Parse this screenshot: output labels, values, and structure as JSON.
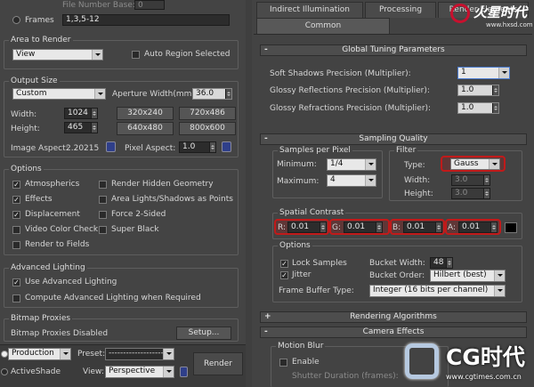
{
  "left": {
    "file_number_base_label": "File Number Base:",
    "file_number_base_value": "0",
    "frames_label": "Frames",
    "frames_value": "1,3,5-12",
    "area_to_render": {
      "title": "Area to Render",
      "selected": "View",
      "auto_region_label": "Auto Region Selected"
    },
    "output_size": {
      "title": "Output Size",
      "preset": "Custom",
      "aperture_label": "Aperture Width(mm):",
      "aperture_value": "36.0",
      "width_label": "Width:",
      "width_value": "1024",
      "height_label": "Height:",
      "height_value": "465",
      "presets": [
        "320x240",
        "720x486",
        "640x480",
        "800x600"
      ],
      "image_aspect_label": "Image Aspect:",
      "image_aspect_value": "2.20215",
      "pixel_aspect_label": "Pixel Aspect:",
      "pixel_aspect_value": "1.0"
    },
    "options": {
      "title": "Options",
      "col1": [
        {
          "label": "Atmospherics",
          "checked": true
        },
        {
          "label": "Effects",
          "checked": true
        },
        {
          "label": "Displacement",
          "checked": true
        },
        {
          "label": "Video Color Check",
          "checked": false
        },
        {
          "label": "Render to Fields",
          "checked": false
        }
      ],
      "col2": [
        {
          "label": "Render Hidden Geometry",
          "checked": false
        },
        {
          "label": "Area Lights/Shadows as Points",
          "checked": false
        },
        {
          "label": "Force 2-Sided",
          "checked": false
        },
        {
          "label": "Super Black",
          "checked": false
        }
      ]
    },
    "advanced_lighting": {
      "title": "Advanced Lighting",
      "use_label": "Use Advanced Lighting",
      "compute_label": "Compute Advanced Lighting when Required"
    },
    "bitmap_proxies": {
      "title": "Bitmap Proxies",
      "status": "Bitmap Proxies Disabled",
      "setup_label": "Setup..."
    },
    "bottom": {
      "production": "Production",
      "activeshade": "ActiveShade",
      "preset_label": "Preset:",
      "preset_value": "--------------------",
      "view_label": "View:",
      "view_value": "Perspective",
      "render_label": "Render"
    }
  },
  "right": {
    "tabs_row1": [
      "Indirect Illumination",
      "Processing",
      "Render Elements"
    ],
    "tabs_row2": [
      "Common"
    ],
    "global_tuning": {
      "title": "Global Tuning Parameters",
      "rows": [
        {
          "label": "Soft Shadows Precision (Multiplier):",
          "value": "1"
        },
        {
          "label": "Glossy Reflections Precision (Multiplier):",
          "value": "1.0"
        },
        {
          "label": "Glossy Refractions Precision (Multiplier):",
          "value": "1.0"
        }
      ]
    },
    "sampling_quality": {
      "title": "Sampling Quality",
      "samples_title": "Samples per Pixel",
      "minimum_label": "Minimum:",
      "minimum_value": "1/4",
      "maximum_label": "Maximum:",
      "maximum_value": "4",
      "filter_title": "Filter",
      "type_label": "Type:",
      "type_value": "Gauss",
      "width_label": "Width:",
      "width_value": "3.0",
      "height_label": "Height:",
      "height_value": "3.0",
      "spatial_title": "Spatial Contrast",
      "spatial": [
        {
          "channel": "R:",
          "value": "0.01"
        },
        {
          "channel": "G:",
          "value": "0.01"
        },
        {
          "channel": "B:",
          "value": "0.01"
        },
        {
          "channel": "A:",
          "value": "0.01"
        }
      ],
      "options_title": "Options",
      "lock_samples_label": "Lock Samples",
      "jitter_label": "Jitter",
      "bucket_width_label": "Bucket Width:",
      "bucket_width_value": "48",
      "bucket_order_label": "Bucket Order:",
      "bucket_order_value": "Hilbert (best)",
      "frame_buffer_label": "Frame Buffer Type:",
      "frame_buffer_value": "Integer (16 bits per channel)"
    },
    "rendering_algorithms": "Rendering Algorithms",
    "camera_effects": {
      "title": "Camera Effects",
      "motion_blur_title": "Motion Blur",
      "enable_label": "Enable",
      "shutter_label": "Shutter Duration (frames):"
    }
  },
  "watermark": {
    "top_brand": "火星时代",
    "top_url": "www.hxsd.com",
    "bottom_brand": "CG时代",
    "bottom_url": "www.cgtimes.com.cn"
  },
  "colors": {
    "highlight": "#c11a1a",
    "panel_bg": "#444444",
    "field_bg": "#2c2c2c"
  }
}
